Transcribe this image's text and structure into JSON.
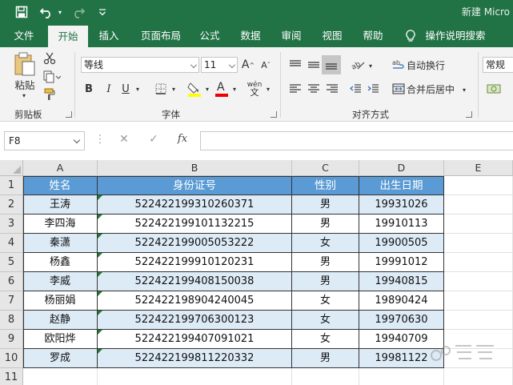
{
  "window": {
    "title": "新建 Micro"
  },
  "tabs": [
    "文件",
    "开始",
    "插入",
    "页面布局",
    "公式",
    "数据",
    "审阅",
    "视图",
    "帮助",
    "操作说明搜索"
  ],
  "ribbon": {
    "clipboard": {
      "paste_label": "粘贴",
      "group_label": "剪贴板"
    },
    "font": {
      "font_name": "等线",
      "font_size": "11",
      "bold": "B",
      "italic": "I",
      "underline": "U",
      "group_label": "字体",
      "grow": "A",
      "shrink": "A",
      "wen": "wén",
      "fontcolor_letter": "A"
    },
    "alignment": {
      "wrap_text": "自动换行",
      "merge_center": "合并后居中",
      "group_label": "对齐方式"
    },
    "number": {
      "format": "常规"
    }
  },
  "formula_bar": {
    "name_box": "F8",
    "fx": "fx",
    "cancel": "✕",
    "enter": "✓",
    "value": ""
  },
  "columns": [
    "A",
    "B",
    "C",
    "D",
    "E"
  ],
  "rows": [
    "1",
    "2",
    "3",
    "4",
    "5",
    "6",
    "7",
    "8",
    "9",
    "10",
    "11"
  ],
  "table": {
    "headers": [
      "姓名",
      "身份证号",
      "性别",
      "出生日期"
    ],
    "rows": [
      [
        "王涛",
        "522422199310260371",
        "男",
        "19931026"
      ],
      [
        "李四海",
        "522422199101132215",
        "男",
        "19910113"
      ],
      [
        "秦潇",
        "522422199005053222",
        "女",
        "19900505"
      ],
      [
        "杨鑫",
        "522422199910120231",
        "男",
        "19991012"
      ],
      [
        "李威",
        "522422199408150038",
        "男",
        "19940815"
      ],
      [
        "杨丽娟",
        "522422198904240045",
        "女",
        "19890424"
      ],
      [
        "赵静",
        "522422199706300123",
        "女",
        "19970630"
      ],
      [
        "欧阳烨",
        "522422199407091021",
        "女",
        "19940709"
      ],
      [
        "罗成",
        "522422199811220332",
        "男",
        "19981122"
      ]
    ]
  },
  "colors": {
    "excel_green": "#217346",
    "header_blue": "#5b9bd5",
    "band_blue": "#ddebf7",
    "error_triangle": "#1e7b34"
  }
}
